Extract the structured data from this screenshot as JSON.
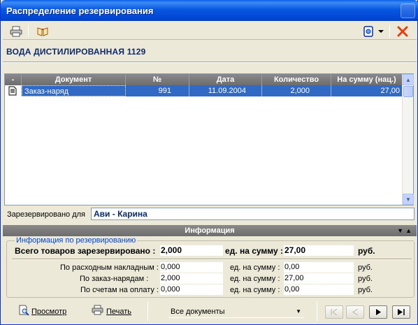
{
  "window": {
    "title": "Распределение резервирования"
  },
  "toolbar": {
    "icons": [
      "printer-icon",
      "book-icon",
      "settings-icon",
      "dropdown-arrow-icon",
      "close-icon"
    ]
  },
  "item": {
    "name": "ВОДА ДИСТИЛИРОВАННАЯ 1129"
  },
  "grid": {
    "columns": [
      "-",
      "Документ",
      "№",
      "Дата",
      "Количество",
      "На сумму (нац.)"
    ],
    "rows": [
      {
        "document": "Заказ-наряд",
        "number": "991",
        "date": "11.09.2004",
        "quantity": "2,000",
        "sum": "27,00"
      }
    ]
  },
  "reserved_for": {
    "label": "Зарезервировано для",
    "value": "Ави - Карина"
  },
  "info_bar": {
    "title": "Информация"
  },
  "reservation_info": {
    "legend": "Информация по резервированию",
    "total_label": "Всего товаров зарезервировано :",
    "total_value": "2,000",
    "total_sum_label": "ед. на сумму :",
    "total_sum_value": "27,00",
    "currency": "руб.",
    "lines": [
      {
        "label": "По расходным накладным :",
        "qty": "0,000",
        "sum_label": "ед. на сумму :",
        "sum": "0,00",
        "currency": "руб."
      },
      {
        "label": "По заказ-нарядам :",
        "qty": "2,000",
        "sum_label": "ед. на сумму :",
        "sum": "27,00",
        "currency": "руб."
      },
      {
        "label": "По счетам на оплату :",
        "qty": "0,000",
        "sum_label": "ед. на сумму :",
        "sum": "0,00",
        "currency": "руб."
      }
    ]
  },
  "footer": {
    "preview_label": "Просмотр",
    "print_label": "Печать",
    "filter_value": "Все документы",
    "nav": [
      "first",
      "prev",
      "next",
      "last"
    ]
  }
}
